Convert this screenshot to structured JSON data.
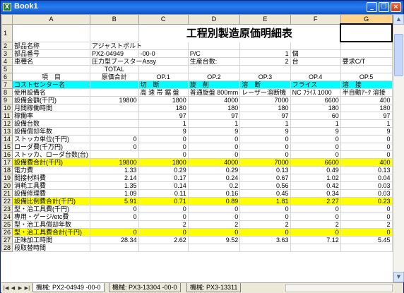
{
  "window": {
    "title": "Book1",
    "minimize": "_",
    "restore": "❐",
    "close": "×",
    "app_icon": "X"
  },
  "columns": [
    "A",
    "B",
    "C",
    "D",
    "E",
    "F",
    "G"
  ],
  "sheet": {
    "title_text": "工程別製造原価明細表",
    "r2": {
      "num": "2",
      "a": "部品名称",
      "b": "アジャストボルト"
    },
    "r3": {
      "num": "3",
      "a": "部品番号",
      "b": "PX2-04949",
      "c": "-00-0",
      "d": "P/C",
      "e": "1",
      "f": "個"
    },
    "r4": {
      "num": "4",
      "a": "車種名",
      "b": "圧力型ブースターAssy",
      "d": "生産台数:",
      "e": "2",
      "f": "台",
      "g": "要求C/T"
    },
    "r5": {
      "num": "5",
      "b": "TOTAL"
    },
    "r6": {
      "num": "6",
      "a": "項　目",
      "b": "原価合計",
      "c": "OP.1",
      "d": "OP.2",
      "e": "OP.3",
      "f": "OP.4",
      "g": "OP.5"
    },
    "r7": {
      "num": "7",
      "a": "コストセンター名",
      "c": "切　断",
      "d": "旋　削",
      "e": "溶　断",
      "f": "フライス",
      "g": "溶　接"
    },
    "r8": {
      "num": "8",
      "a": "使用設備名",
      "c": "高 速 帯 鋸 盤",
      "d": "普通旋盤 800mm",
      "e": "レーザー溶断機",
      "f": "NC ﾌﾗｲｽ 1000",
      "g": "半自動ｱｰｸ 溶接"
    },
    "rows": [
      {
        "num": "9",
        "a": "設備金額(千円)",
        "b": "19800",
        "c": "1800",
        "d": "4000",
        "e": "7000",
        "f": "6600",
        "g": "400"
      },
      {
        "num": "10",
        "a": "月間稼働時間",
        "b": "",
        "c": "180",
        "d": "180",
        "e": "180",
        "f": "180",
        "g": "180"
      },
      {
        "num": "11",
        "a": "稼働率",
        "b": "",
        "c": "97",
        "d": "97",
        "e": "97",
        "f": "60",
        "g": "97"
      },
      {
        "num": "12",
        "a": "設備台数",
        "b": "",
        "c": "1",
        "d": "1",
        "e": "1",
        "f": "1",
        "g": "1"
      },
      {
        "num": "13",
        "a": "設備償却年数",
        "b": "",
        "c": "9",
        "d": "9",
        "e": "9",
        "f": "9",
        "g": "9"
      },
      {
        "num": "14",
        "a": "ストッカ単位(千円)",
        "b": "0",
        "c": "0",
        "d": "0",
        "e": "0",
        "f": "0",
        "g": "0"
      },
      {
        "num": "15",
        "a": "ローダ費(千万円)",
        "b": "0",
        "c": "0",
        "d": "0",
        "e": "0",
        "f": "0",
        "g": "0"
      },
      {
        "num": "16",
        "a": "ストッカ、ローダ台数(台)",
        "b": "",
        "c": "0",
        "d": "0",
        "e": "0",
        "f": "0",
        "g": "0"
      },
      {
        "num": "17",
        "a": "設備費合計(千円)",
        "b": "19800",
        "c": "1800",
        "d": "4000",
        "e": "7000",
        "f": "6600",
        "g": "400",
        "hl": true
      },
      {
        "num": "18",
        "a": "電力費",
        "b": "1.33",
        "c": "0.29",
        "d": "0.29",
        "e": "0.13",
        "f": "0.49",
        "g": "0.13"
      },
      {
        "num": "19",
        "a": "間接材料費",
        "b": "2.14",
        "c": "0.17",
        "d": "0.24",
        "e": "0.67",
        "f": "1.02",
        "g": "0.04"
      },
      {
        "num": "20",
        "a": "消耗工具費",
        "b": "1.35",
        "c": "0.14",
        "d": "0.2",
        "e": "0.56",
        "f": "0.42",
        "g": "0.03"
      },
      {
        "num": "21",
        "a": "設備修理費",
        "b": "1.09",
        "c": "0.11",
        "d": "0.16",
        "e": "0.45",
        "f": "0.34",
        "g": "0.03"
      },
      {
        "num": "22",
        "a": "設備比例費合計(千円)",
        "b": "5.91",
        "c": "0.71",
        "d": "0.89",
        "e": "1.81",
        "f": "2.27",
        "g": "0.23",
        "hl": true
      },
      {
        "num": "23",
        "a": "型・治工具費(千円)",
        "b": "0",
        "c": "0",
        "d": "0",
        "e": "0",
        "f": "0",
        "g": "0"
      },
      {
        "num": "24",
        "a": "専用・ゲージ/etc費",
        "b": "0",
        "c": "0",
        "d": "0",
        "e": "0",
        "f": "0",
        "g": "0"
      },
      {
        "num": "25",
        "a": "型・治工具償却年数",
        "b": "",
        "c": "2",
        "d": "2",
        "e": "2",
        "f": "2",
        "g": "2"
      },
      {
        "num": "26",
        "a": "型・治工具費合計(千円)",
        "b": "0",
        "c": "0",
        "d": "0",
        "e": "0",
        "f": "0",
        "g": "0",
        "hl": true
      },
      {
        "num": "27",
        "a": "正味加工時間",
        "b": "28.34",
        "c": "2.62",
        "d": "9.52",
        "e": "3.63",
        "f": "7.12",
        "g": "5.45"
      },
      {
        "num": "28",
        "a": "段取替時間",
        "b": "",
        "c": "",
        "d": "",
        "e": "",
        "f": "",
        "g": ""
      }
    ]
  },
  "tabs": [
    {
      "label": "機械: PX2-04949 -00-0",
      "active": true
    },
    {
      "label": "機械: PX3-13304 -00-0",
      "active": false
    },
    {
      "label": "機械: PX3-13311",
      "active": false
    }
  ],
  "nav": {
    "first": "|◀",
    "prev": "◀",
    "next": "▶",
    "last": "▶|"
  },
  "scroll": {
    "up": "▲",
    "down": "▼"
  }
}
